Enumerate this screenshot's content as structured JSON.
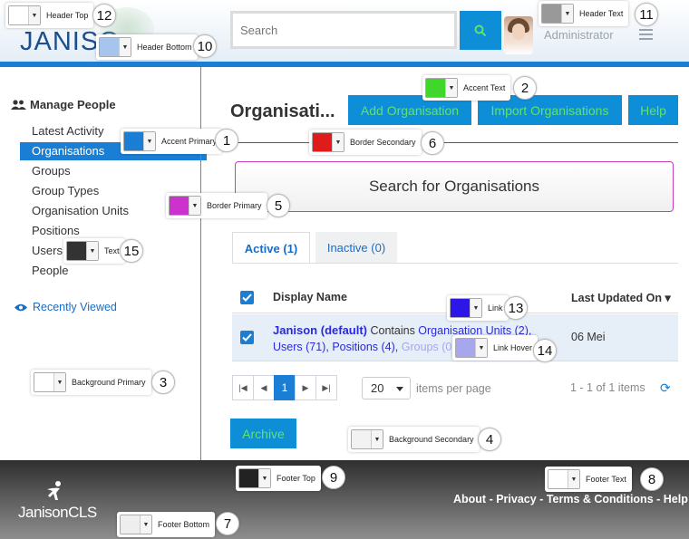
{
  "header": {
    "logo_text": "JANISO",
    "search_placeholder": "Search",
    "user_label": "Administrator"
  },
  "sidebar": {
    "heading": "Manage People",
    "items": [
      {
        "label": "Latest Activity"
      },
      {
        "label": "Organisations",
        "active": true
      },
      {
        "label": "Groups"
      },
      {
        "label": "Group Types"
      },
      {
        "label": "Organisation Units"
      },
      {
        "label": "Positions"
      },
      {
        "label": "Users"
      },
      {
        "label": "People"
      }
    ],
    "recent_label": "Recently Viewed"
  },
  "main": {
    "title": "Organisati...",
    "buttons": {
      "add": "Add Organisation",
      "import": "Import Organisations",
      "help": "Help"
    },
    "search_org_label": "Search for Organisations",
    "tabs": [
      {
        "label": "Active (1)",
        "active": true
      },
      {
        "label": "Inactive (0)",
        "active": false
      }
    ],
    "grid": {
      "col_name": "Display Name",
      "col_date": "Last Updated On ▾",
      "row": {
        "org_name": "Janison (default)",
        "contains": " Contains ",
        "units": "Organisation Units (2),",
        "users": "Users (71),",
        "positions": "Positions (4),",
        "groups": "Groups (0)",
        "date": "06 Mei"
      }
    },
    "pager": {
      "current": "1",
      "per_page": "20",
      "per_page_label": "items per page",
      "count": "1 - 1 of 1 items"
    },
    "archive_label": "Archive"
  },
  "footer": {
    "logo_text": "JanisonCLS",
    "links": [
      "About",
      "Privacy",
      "Terms & Conditions",
      "Help"
    ],
    "sep": " - "
  },
  "swatches": [
    {
      "num": "1",
      "label": "Accent Primary",
      "color": "#1a7fd4"
    },
    {
      "num": "2",
      "label": "Accent Text",
      "color": "#3ed72a"
    },
    {
      "num": "3",
      "label": "Background Primary",
      "color": "#ffffff"
    },
    {
      "num": "4",
      "label": "Background Secondary",
      "color": "#f2f2f2"
    },
    {
      "num": "5",
      "label": "Border Primary",
      "color": "#cc33cc"
    },
    {
      "num": "6",
      "label": "Border Secondary",
      "color": "#e01b1b"
    },
    {
      "num": "7",
      "label": "Footer Bottom",
      "color": "#eeeeee"
    },
    {
      "num": "8",
      "label": "Footer Text",
      "color": "#ffffff"
    },
    {
      "num": "9",
      "label": "Footer Top",
      "color": "#222222"
    },
    {
      "num": "10",
      "label": "Header Bottom",
      "color": "#a6c4ec"
    },
    {
      "num": "11",
      "label": "Header Text",
      "color": "#999999"
    },
    {
      "num": "12",
      "label": "Header Top",
      "color": "#ffffff"
    },
    {
      "num": "13",
      "label": "Link",
      "color": "#2b17e6"
    },
    {
      "num": "14",
      "label": "Link Hover",
      "color": "#a7a7ed"
    },
    {
      "num": "15",
      "label": "Text",
      "color": "#333333"
    }
  ]
}
